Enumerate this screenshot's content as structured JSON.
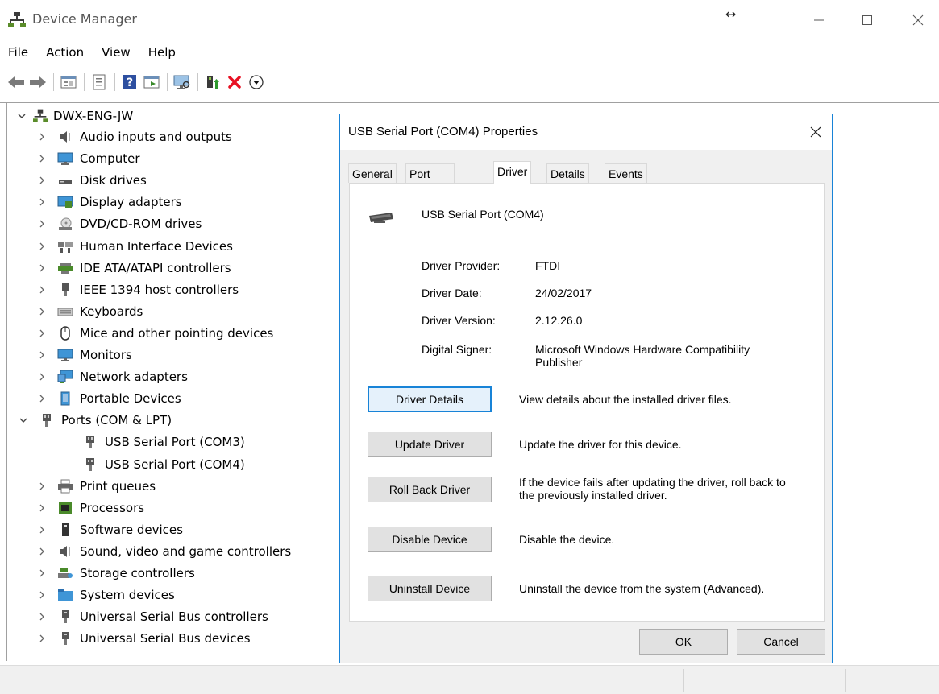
{
  "window": {
    "title": "Device Manager"
  },
  "menu": [
    "File",
    "Action",
    "View",
    "Help"
  ],
  "tree": {
    "root": "DWX-ENG-JW",
    "categories": [
      "Audio inputs and outputs",
      "Computer",
      "Disk drives",
      "Display adapters",
      "DVD/CD-ROM drives",
      "Human Interface Devices",
      "IDE ATA/ATAPI controllers",
      "IEEE 1394 host controllers",
      "Keyboards",
      "Mice and other pointing devices",
      "Monitors",
      "Network adapters",
      "Portable Devices",
      "Ports (COM & LPT)",
      "Print queues",
      "Processors",
      "Software devices",
      "Sound, video and game controllers",
      "Storage controllers",
      "System devices",
      "Universal Serial Bus controllers",
      "Universal Serial Bus devices"
    ],
    "ports_children": [
      "USB Serial Port (COM3)",
      "USB Serial Port (COM4)"
    ]
  },
  "dialog": {
    "title": "USB Serial Port (COM4) Properties",
    "tabs": [
      "General",
      "Port Settings",
      "Driver",
      "Details",
      "Events"
    ],
    "active_tab": "Driver",
    "device_name": "USB Serial Port (COM4)",
    "properties": [
      {
        "label": "Driver Provider:",
        "value": "FTDI"
      },
      {
        "label": "Driver Date:",
        "value": "24/02/2017"
      },
      {
        "label": "Driver Version:",
        "value": "2.12.26.0"
      },
      {
        "label": "Digital Signer:",
        "value": "Microsoft Windows Hardware Compatibility Publisher"
      }
    ],
    "actions": [
      {
        "label": "Driver Details",
        "description": "View details about the installed driver files."
      },
      {
        "label": "Update Driver",
        "description": "Update the driver for this device."
      },
      {
        "label": "Roll Back Driver",
        "description": "If the device fails after updating the driver, roll back to the previously installed driver."
      },
      {
        "label": "Disable Device",
        "description": "Disable the device."
      },
      {
        "label": "Uninstall Device",
        "description": "Uninstall the device from the system (Advanced)."
      }
    ],
    "ok_label": "OK",
    "cancel_label": "Cancel"
  },
  "colors": {
    "accent": "#1883d7",
    "delete_red": "#e81123",
    "status_bar": "#f0f0f0"
  }
}
